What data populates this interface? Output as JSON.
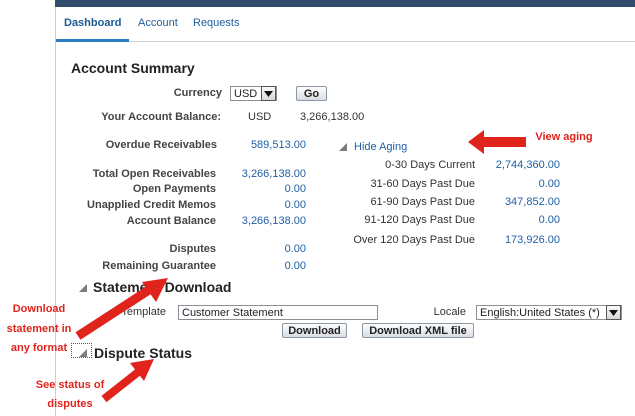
{
  "tabs": [
    "Dashboard",
    "Account",
    "Requests"
  ],
  "account_summary": {
    "title": "Account Summary",
    "currency_label": "Currency",
    "currency_value": "USD",
    "go_label": "Go",
    "balance_label": "Your Account Balance:",
    "balance_currency": "USD",
    "balance_value": "3,266,138.00",
    "overdue_label": "Overdue Receivables",
    "overdue_value": "589,513.00",
    "total_open_label": "Total Open Receivables",
    "total_open_value": "3,266,138.00",
    "open_payments_label": "Open Payments",
    "open_payments_value": "0.00",
    "unapplied_label": "Unapplied Credit Memos",
    "unapplied_value": "0.00",
    "account_balance_label": "Account Balance",
    "account_balance_value": "3,266,138.00",
    "disputes_label": "Disputes",
    "disputes_value": "0.00",
    "remaining_label": "Remaining Guarantee",
    "remaining_value": "0.00"
  },
  "aging": {
    "toggle_label": "Hide Aging",
    "rows": [
      {
        "label": "0-30 Days Current",
        "value": "2,744,360.00"
      },
      {
        "label": "31-60 Days Past Due",
        "value": "0.00"
      },
      {
        "label": "61-90 Days Past Due",
        "value": "347,852.00"
      },
      {
        "label": "91-120 Days Past Due",
        "value": "0.00"
      },
      {
        "label": "Over 120 Days Past Due",
        "value": "173,926.00"
      }
    ]
  },
  "statement_download": {
    "title": "Statement Download",
    "template_label": "Template",
    "template_value": "Customer Statement",
    "locale_label": "Locale",
    "locale_value": "English:United States (*)",
    "download_label": "Download",
    "download_xml_label": "Download XML file"
  },
  "dispute_status": {
    "title": "Dispute Status"
  },
  "annotations": {
    "view_aging": "View aging",
    "download_line1": "Download",
    "download_line2": "statement in",
    "download_line3": "any format",
    "status_line1": "See status of",
    "status_line2": "disputes"
  },
  "colors": {
    "link": "#1f5fa6",
    "annotation": "#e0231b",
    "topbar": "#2f4d6a"
  }
}
